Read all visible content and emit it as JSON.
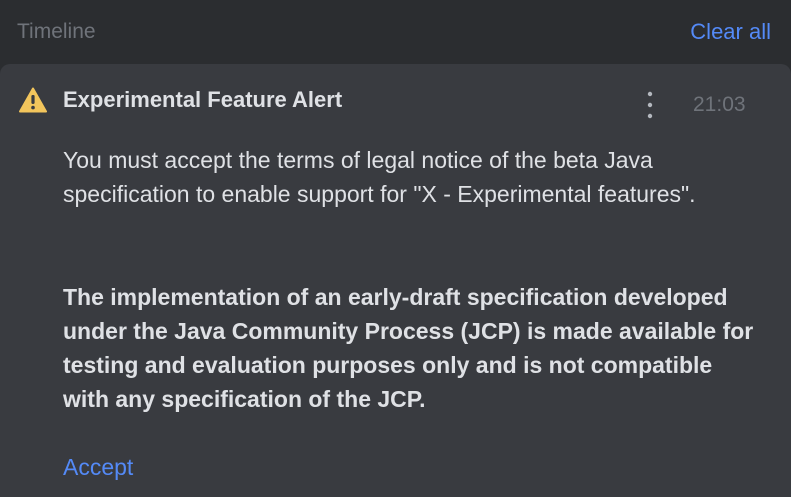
{
  "header": {
    "title": "Timeline",
    "clear_all_label": "Clear all"
  },
  "notification": {
    "icon": "warning-icon",
    "title": "Experimental Feature Alert",
    "more_icon": "more-vertical-icon",
    "time": "21:03",
    "message": "You must accept the terms of legal notice of the beta Java specification to enable support for \"X - Experimental features\".",
    "notice": "The implementation of an early-draft specification developed under the Java Community Process (JCP) is made available for testing and evaluation purposes only and is not compatible with any specification of the JCP.",
    "action_label": "Accept"
  },
  "colors": {
    "background": "#2b2d30",
    "card": "#393b40",
    "text": "#dfe1e5",
    "muted": "#6f737a",
    "link": "#548af7",
    "warning": "#f2c55c"
  }
}
